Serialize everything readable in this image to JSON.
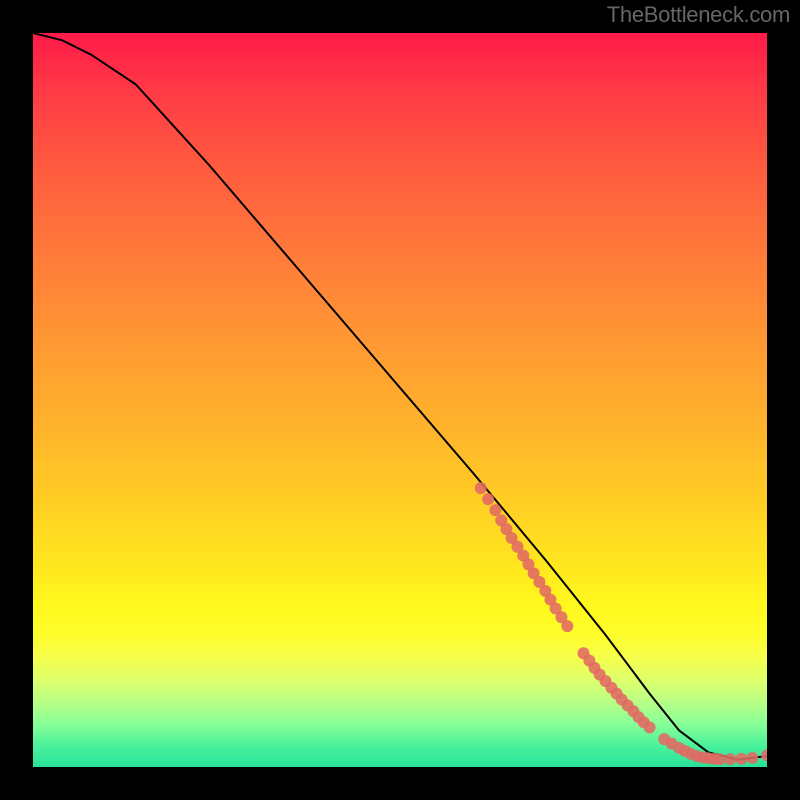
{
  "watermark": "TheBottleneck.com",
  "chart_data": {
    "type": "line",
    "title": "",
    "xlabel": "",
    "ylabel": "",
    "xlim": [
      0,
      100
    ],
    "ylim": [
      0,
      100
    ],
    "grid": false,
    "legend": false,
    "series": [
      {
        "name": "curve",
        "style": "line-black",
        "x": [
          0,
          4,
          8,
          14,
          24,
          36,
          48,
          60,
          70,
          78,
          84,
          88,
          92,
          96,
          100
        ],
        "y": [
          100,
          99,
          97,
          93,
          82,
          68,
          54,
          40,
          28,
          18,
          10,
          5,
          2,
          1,
          1.5
        ]
      },
      {
        "name": "segment-a-dots",
        "style": "dots-salmon",
        "x": [
          61,
          62,
          63,
          63.8,
          64.5,
          65.2,
          66,
          66.8,
          67.5,
          68.2,
          69,
          69.8,
          70.5,
          71.2,
          72,
          72.8
        ],
        "y": [
          38,
          36.5,
          35,
          33.6,
          32.4,
          31.2,
          30,
          28.8,
          27.6,
          26.4,
          25.2,
          24,
          22.8,
          21.6,
          20.4,
          19.2
        ]
      },
      {
        "name": "segment-b-dots",
        "style": "dots-salmon",
        "x": [
          75,
          75.8,
          76.5,
          77.2,
          78,
          78.8,
          79.5,
          80.2,
          81,
          81.8,
          82.5,
          83.2,
          84
        ],
        "y": [
          15.5,
          14.5,
          13.5,
          12.6,
          11.7,
          10.8,
          10.0,
          9.2,
          8.4,
          7.6,
          6.8,
          6.1,
          5.4
        ]
      },
      {
        "name": "segment-c-dots",
        "style": "dots-salmon",
        "x": [
          86,
          87,
          88,
          88.8,
          89.6,
          90.4,
          91.2,
          92,
          92.8,
          93.6
        ],
        "y": [
          3.8,
          3.2,
          2.6,
          2.2,
          1.8,
          1.5,
          1.3,
          1.2,
          1.1,
          1.05
        ]
      },
      {
        "name": "segment-d-dots",
        "style": "dots-salmon",
        "x": [
          95,
          96.5,
          98,
          100
        ],
        "y": [
          1.05,
          1.1,
          1.25,
          1.6
        ]
      }
    ]
  }
}
